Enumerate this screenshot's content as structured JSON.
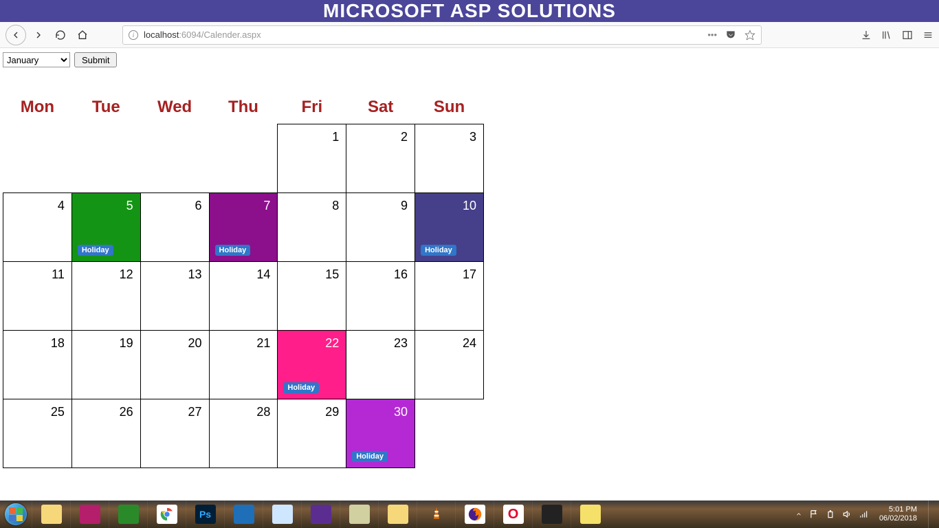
{
  "banner": {
    "title": "MICROSOFT ASP SOLUTIONS"
  },
  "url": {
    "host": "localhost",
    "port_path": ":6094/Calender.aspx"
  },
  "controls": {
    "month_selected": "January",
    "submit_label": "Submit"
  },
  "calendar": {
    "headers": [
      "Mon",
      "Tue",
      "Wed",
      "Thu",
      "Fri",
      "Sat",
      "Sun"
    ],
    "weeks": [
      [
        {
          "blank": true
        },
        {
          "blank": true
        },
        {
          "blank": true
        },
        {
          "blank": true
        },
        {
          "day": "1"
        },
        {
          "day": "2"
        },
        {
          "day": "3"
        }
      ],
      [
        {
          "day": "4"
        },
        {
          "day": "5",
          "bg": "bg-green",
          "holiday": "Holiday"
        },
        {
          "day": "6"
        },
        {
          "day": "7",
          "bg": "bg-purple",
          "holiday": "Holiday"
        },
        {
          "day": "8"
        },
        {
          "day": "9"
        },
        {
          "day": "10",
          "bg": "bg-navy",
          "holiday": "Holiday"
        }
      ],
      [
        {
          "day": "11"
        },
        {
          "day": "12"
        },
        {
          "day": "13"
        },
        {
          "day": "14"
        },
        {
          "day": "15"
        },
        {
          "day": "16"
        },
        {
          "day": "17"
        }
      ],
      [
        {
          "day": "18"
        },
        {
          "day": "19"
        },
        {
          "day": "20"
        },
        {
          "day": "21"
        },
        {
          "day": "22",
          "bg": "bg-pink",
          "holiday": "Holiday"
        },
        {
          "day": "23"
        },
        {
          "day": "24"
        }
      ],
      [
        {
          "day": "25"
        },
        {
          "day": "26"
        },
        {
          "day": "27"
        },
        {
          "day": "28"
        },
        {
          "day": "29"
        },
        {
          "day": "30",
          "bg": "bg-violet",
          "holiday": "Holiday"
        },
        {
          "blank": true,
          "last": true
        }
      ]
    ]
  },
  "taskbar": {
    "icons": [
      {
        "name": "file-explorer",
        "bg": "#f6d77a",
        "label": ""
      },
      {
        "name": "heidi-sql",
        "bg": "#b41e6a",
        "label": ""
      },
      {
        "name": "viewer",
        "bg": "#2a8a2a",
        "label": ""
      },
      {
        "name": "chrome",
        "bg": "#ffffff",
        "label": ""
      },
      {
        "name": "photoshop",
        "bg": "#001e36",
        "label": "Ps"
      },
      {
        "name": "vscode",
        "bg": "#1e6fb8",
        "label": ""
      },
      {
        "name": "notepad",
        "bg": "#cfe6ff",
        "label": ""
      },
      {
        "name": "visual-studio",
        "bg": "#5c2d91",
        "label": ""
      },
      {
        "name": "putty",
        "bg": "#d0d0a0",
        "label": ""
      },
      {
        "name": "explorer2",
        "bg": "#f6d77a",
        "label": ""
      },
      {
        "name": "vlc",
        "bg": "#e76f00",
        "label": ""
      },
      {
        "name": "firefox",
        "bg": "#ffffff",
        "label": ""
      },
      {
        "name": "opera",
        "bg": "#ffffff",
        "label": "O"
      },
      {
        "name": "terminal",
        "bg": "#222",
        "label": ""
      },
      {
        "name": "sticky-notes",
        "bg": "#f5e06a",
        "label": ""
      }
    ]
  },
  "clock": {
    "time": "5:01 PM",
    "date": "06/02/2018"
  }
}
